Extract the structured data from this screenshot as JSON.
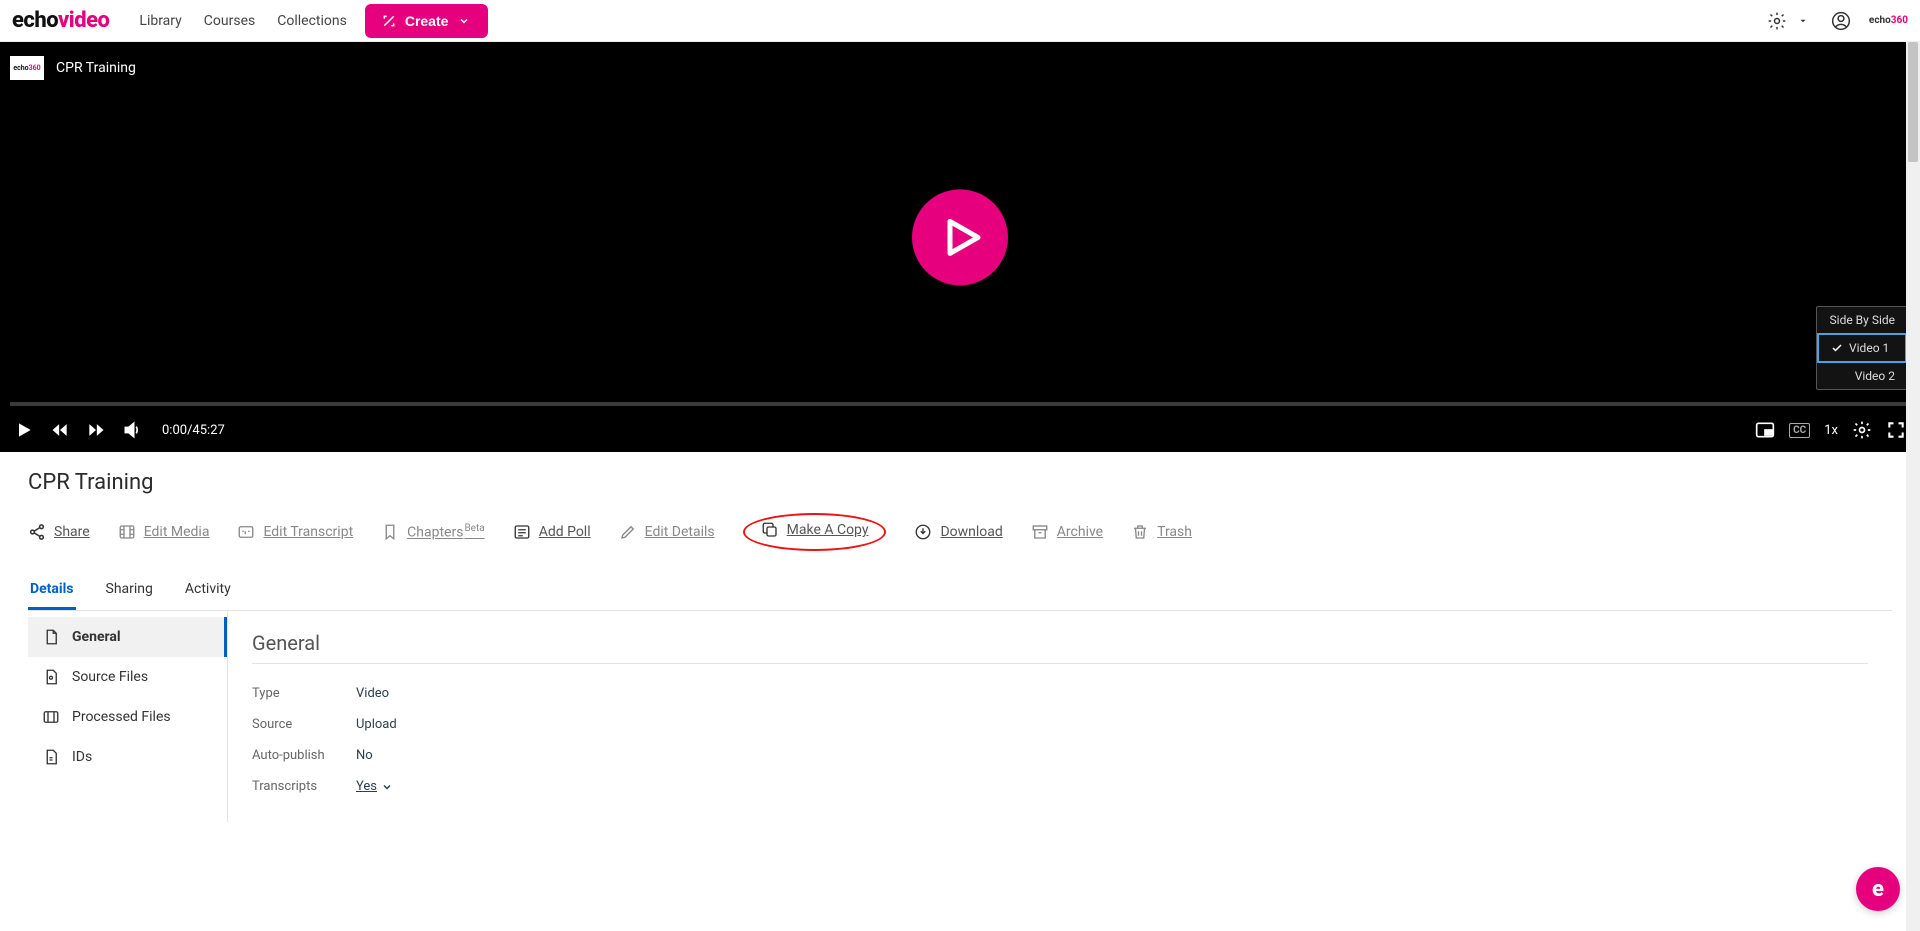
{
  "nav": {
    "logo_a": "echo",
    "logo_b": "video",
    "links": {
      "library": "Library",
      "courses": "Courses",
      "collections": "Collections"
    },
    "create": "Create"
  },
  "player": {
    "title": "CPR Training",
    "time": "0:00/45:27",
    "speed": "1x",
    "layout": {
      "sbs": "Side By Side",
      "v1": "Video 1",
      "v2": "Video 2"
    }
  },
  "page": {
    "title": "CPR Training"
  },
  "actions": {
    "share": "Share",
    "edit_media": "Edit Media",
    "edit_transcript": "Edit Transcript",
    "chapters": "Chapters",
    "chapters_sup": "Beta",
    "add_poll": "Add Poll",
    "edit_details": "Edit Details",
    "make_copy": "Make A Copy",
    "download": "Download",
    "archive": "Archive",
    "trash": "Trash"
  },
  "tabs": {
    "details": "Details",
    "sharing": "Sharing",
    "activity": "Activity"
  },
  "sidenav": {
    "general": "General",
    "source": "Source Files",
    "processed": "Processed Files",
    "ids": "IDs"
  },
  "section": {
    "heading": "General",
    "rows": {
      "type_k": "Type",
      "type_v": "Video",
      "source_k": "Source",
      "source_v": "Upload",
      "autopub_k": "Auto-publish",
      "autopub_v": "No",
      "transcripts_k": "Transcripts",
      "transcripts_v": "Yes"
    }
  }
}
